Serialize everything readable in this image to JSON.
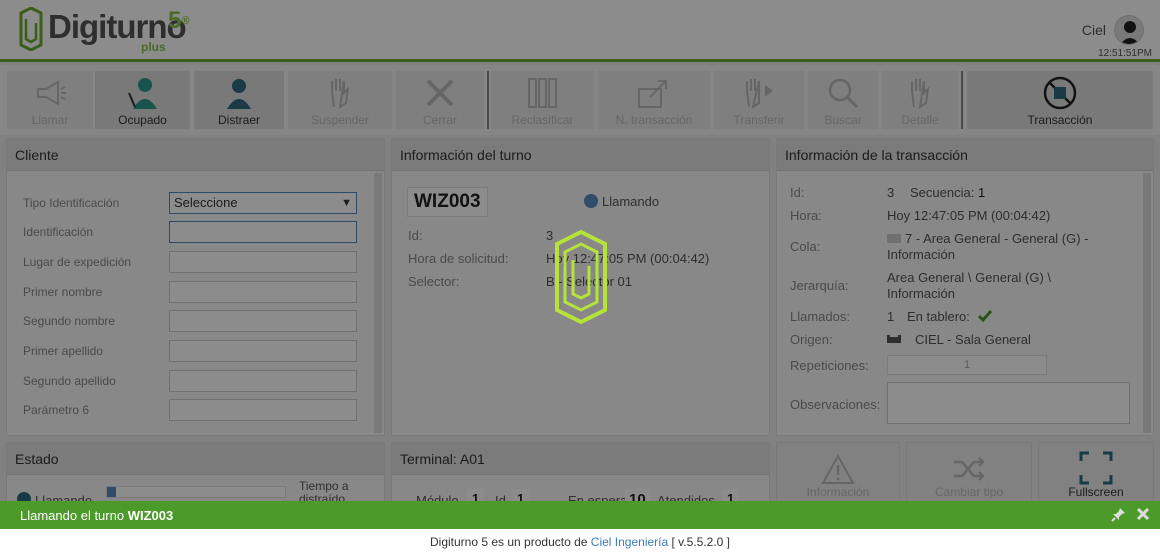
{
  "header": {
    "brand_word": "Digiturno",
    "brand_number": "5",
    "brand_reg": "®",
    "brand_suffix": "plus",
    "user_name": "Ciel",
    "clock": "12:51:51PM"
  },
  "toolbar": {
    "buttons": [
      {
        "label": "Llamar",
        "icon": "megaphone-icon",
        "enabled": false
      },
      {
        "label": "Ocupado",
        "icon": "busy-agent-icon",
        "enabled": true
      },
      {
        "label": "Distraer",
        "icon": "distract-agent-icon",
        "enabled": true
      },
      {
        "label": "Suspender",
        "icon": "hand-stop-icon",
        "enabled": false
      },
      {
        "label": "Cerrar",
        "icon": "close-x-icon",
        "enabled": false
      },
      {
        "label": "Reclasificar",
        "icon": "reclassify-icon",
        "enabled": false
      },
      {
        "label": "N. transacción",
        "icon": "new-transaction-icon",
        "enabled": false
      },
      {
        "label": "Transferir",
        "icon": "transfer-icon",
        "enabled": false
      },
      {
        "label": "Buscar",
        "icon": "magnifier-icon",
        "enabled": false
      },
      {
        "label": "Detalle",
        "icon": "detail-hand-icon",
        "enabled": false
      },
      {
        "label": "Transacción",
        "icon": "no-transaction-icon",
        "enabled": true
      }
    ]
  },
  "cliente": {
    "title": "Cliente",
    "fields": [
      {
        "label": "Tipo Identificación",
        "value": "Seleccione"
      },
      {
        "label": "Identificación",
        "value": ""
      },
      {
        "label": "Lugar de expedición",
        "value": ""
      },
      {
        "label": "Primer nombre",
        "value": ""
      },
      {
        "label": "Segundo nombre",
        "value": ""
      },
      {
        "label": "Primer apellido",
        "value": ""
      },
      {
        "label": "Segundo apellido",
        "value": ""
      },
      {
        "label": "Parámetro 6",
        "value": ""
      }
    ]
  },
  "turno": {
    "title": "Información del turno",
    "code": "WIZ003",
    "status": "Llamando",
    "id_label": "Id:",
    "id_value": "3",
    "hora_label": "Hora de solicitud:",
    "hora_value": "Hoy 12:47:05 PM (00:04:42)",
    "selector_label": "Selector:",
    "selector_value": "B - Selector 01"
  },
  "transaccion": {
    "title": "Información de la transacción",
    "id_label": "Id:",
    "id_value": "3",
    "secuencia_label": "Secuencia:",
    "secuencia_value": "1",
    "hora_label": "Hora:",
    "hora_value": "Hoy 12:47:05 PM (00:04:42)",
    "cola_label": "Cola:",
    "cola_value": "7 - Area General - General (G) - Información",
    "jerarquia_label": "Jerarquía:",
    "jerarquia_value": "Area General \\ General (G) \\ Información",
    "llamados_label": "Llamados:",
    "llamados_value": "1",
    "tablero_label": "En tablero:",
    "origen_label": "Origen:",
    "origen_value": "CIEL - Sala General",
    "repeticiones_label": "Repeticiones:",
    "repeticiones_value": "1",
    "observaciones_label": "Observaciones:"
  },
  "estado": {
    "title": "Estado",
    "state": "Llamando",
    "progress": 0.05,
    "tiempo_label": "Tiempo a distraído"
  },
  "terminal": {
    "title": "Terminal: A01",
    "modulo_label": "Módulo",
    "modulo_value": "1",
    "id_label": "Id",
    "id_value": "1",
    "espera_label": "En espera",
    "espera_value": "10",
    "atendidos_label": "Atendidos",
    "atendidos_value": "1"
  },
  "actions": [
    {
      "label": "Información",
      "icon": "warning-icon",
      "enabled": false
    },
    {
      "label": "Cambiar tipo",
      "icon": "shuffle-icon",
      "enabled": false
    },
    {
      "label": "Fullscreen",
      "icon": "fullscreen-icon",
      "enabled": true
    }
  ],
  "status_bar": {
    "prefix": "Llamando el turno",
    "code": "WIZ003"
  },
  "footer": {
    "text": "Digiturno 5 es un producto de",
    "link": "Ciel Ingeniería",
    "version": "[ v.5.5.2.0 ]"
  },
  "colors": {
    "brand_green": "#6aaa2e",
    "status_green": "#4c9a2a",
    "loader_green": "#b5e23b",
    "status_dot": "#5a8cc2"
  }
}
